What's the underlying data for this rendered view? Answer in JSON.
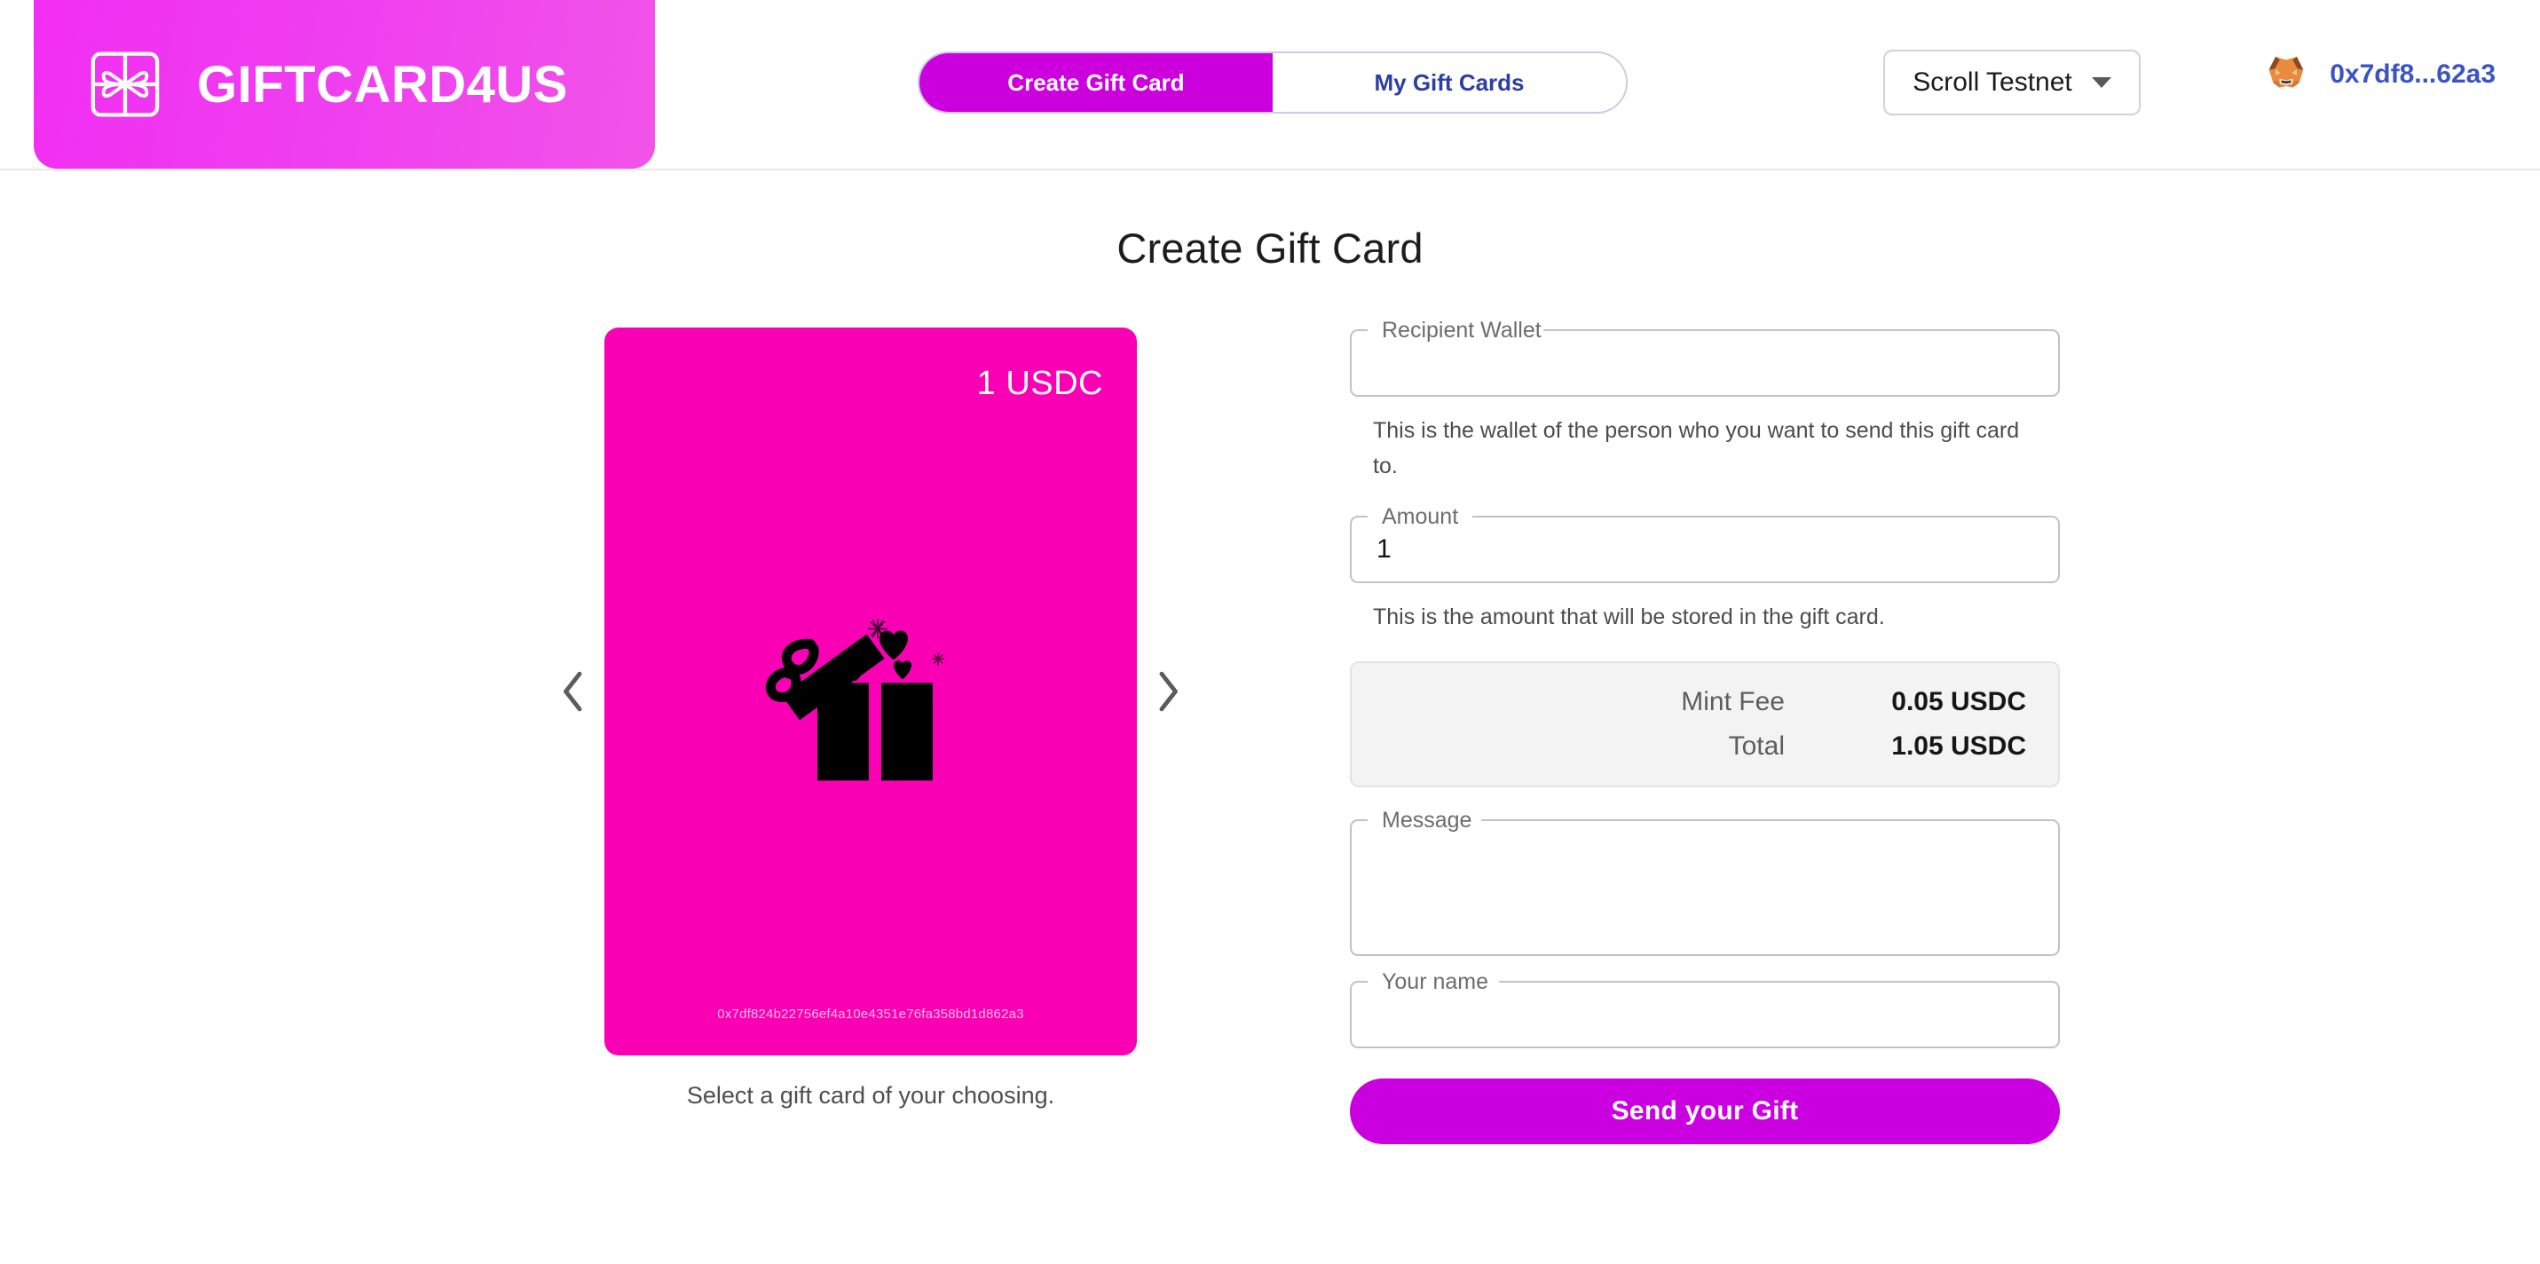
{
  "brand": {
    "name": "GIFTCARD4US",
    "logo_icon": "gift-card-icon",
    "banner_color": "#f22ef2"
  },
  "header": {
    "tabs": [
      {
        "label": "Create Gift Card",
        "active": true
      },
      {
        "label": "My Gift Cards",
        "active": false
      }
    ],
    "network": {
      "selected": "Scroll Testnet",
      "caret_icon": "chevron-down-icon"
    },
    "wallet": {
      "provider_icon": "metamask-fox-icon",
      "address_short": "0x7df8...62a3",
      "address_color": "#3b54c4"
    }
  },
  "page": {
    "title": "Create Gift Card"
  },
  "carousel": {
    "prev_icon": "chevron-left-icon",
    "next_icon": "chevron-right-icon",
    "caption": "Select a gift card of your choosing.",
    "card": {
      "amount": "1 USDC",
      "background_color": "#fa00b4",
      "graphic_icon": "open-gift-box-with-hearts-icon",
      "address_full": "0x7df824b22756ef4a10e4351e76fa358bd1d862a3"
    }
  },
  "form": {
    "recipient": {
      "label": "Recipient Wallet",
      "value": "",
      "placeholder": "",
      "helper": "This is the wallet of the person who you want to send this gift card to."
    },
    "amount": {
      "label": "Amount",
      "value": "1",
      "placeholder": "",
      "helper": "This is the amount that will be stored in the gift card."
    },
    "fees": {
      "rows": [
        {
          "label": "Mint Fee",
          "value": "0.05 USDC"
        },
        {
          "label": "Total",
          "value": "1.05 USDC"
        }
      ]
    },
    "message": {
      "label": "Message",
      "value": "",
      "placeholder": ""
    },
    "your_name": {
      "label": "Your name",
      "value": "",
      "placeholder": ""
    },
    "submit_label": "Send your Gift"
  }
}
